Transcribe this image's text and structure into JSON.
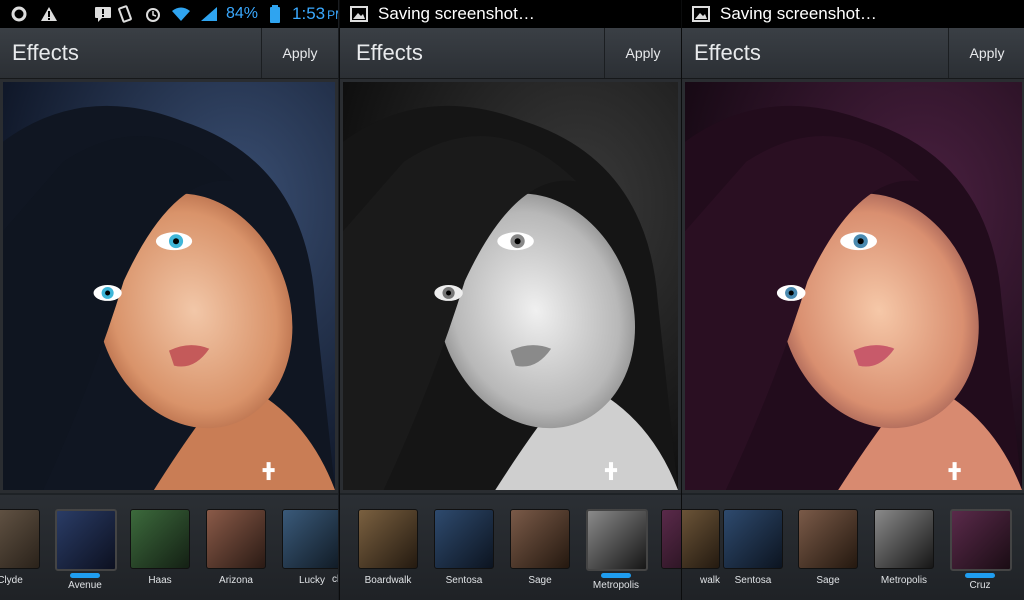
{
  "panels": [
    {
      "status": {
        "battery_pct": "84%",
        "time": "1:53",
        "ampm": "PM"
      },
      "title": "Effects",
      "apply_label": "Apply",
      "filter": "cool",
      "thumbs": [
        {
          "label": "Clyde",
          "tint": "#6a5a4a"
        },
        {
          "label": "Avenue",
          "tint": "#2a3c66",
          "selected": true
        },
        {
          "label": "Haas",
          "tint": "#3c6a3c"
        },
        {
          "label": "Arizona",
          "tint": "#8a5a48"
        },
        {
          "label": "Lucky",
          "tint": "#3a5a7a"
        },
        {
          "label": "cl",
          "tint": "#555"
        }
      ]
    },
    {
      "notice": "Saving screenshot…",
      "title": "Effects",
      "apply_label": "Apply",
      "filter": "mono",
      "thumbs": [
        {
          "label": "Boardwalk",
          "tint": "#7a6040"
        },
        {
          "label": "Sentosa",
          "tint": "#2e4a6e"
        },
        {
          "label": "Sage",
          "tint": "#7a5a48"
        },
        {
          "label": "Metropolis",
          "tint": "#777777",
          "selected": true
        },
        {
          "label": "",
          "tint": "#5a2a4a"
        }
      ]
    },
    {
      "notice": "Saving screenshot…",
      "title": "Effects",
      "apply_label": "Apply",
      "filter": "purple",
      "thumbs": [
        {
          "label": "walk",
          "tint": "#7a6040"
        },
        {
          "label": "Sentosa",
          "tint": "#2e4a6e"
        },
        {
          "label": "Sage",
          "tint": "#7a5a48"
        },
        {
          "label": "Metropolis",
          "tint": "#777777"
        },
        {
          "label": "Cruz",
          "tint": "#5a2a4a",
          "selected": true
        }
      ]
    }
  ]
}
